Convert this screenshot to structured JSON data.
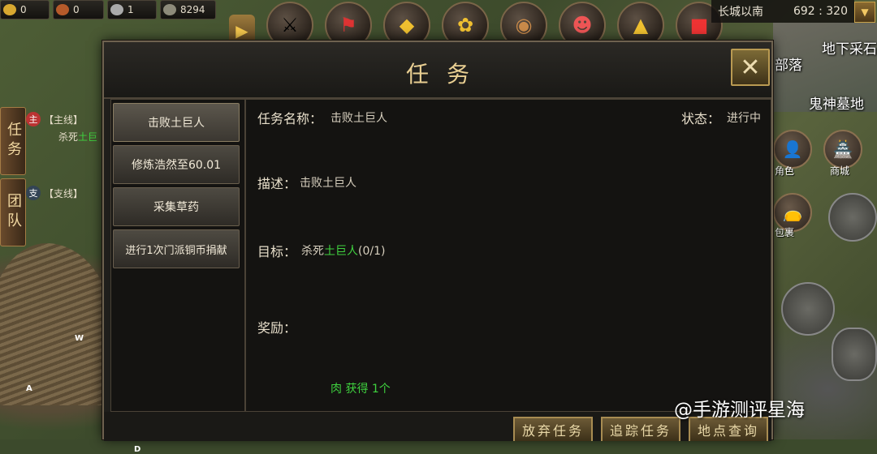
{
  "resources": [
    {
      "icon": "gold-ingot-icon",
      "value": "0"
    },
    {
      "icon": "medal-icon",
      "value": "0"
    },
    {
      "icon": "silver-coin-icon",
      "value": "1"
    },
    {
      "icon": "sack-icon",
      "value": "8294"
    }
  ],
  "top_icons": [
    "expand-arrow-icon",
    "warrior-icon",
    "flag-icon",
    "ingot-icon",
    "gold-tree-icon",
    "shield-icon",
    "mask-icon",
    "treasure-icon",
    "gift-box-icon"
  ],
  "location": {
    "name": "长城以南",
    "coords": "692 : 320"
  },
  "map_labels": {
    "tribe": "部落",
    "cave": "地下采石",
    "tomb": "鬼神墓地"
  },
  "side_tabs": {
    "quest": "任务",
    "team": "团队"
  },
  "tracker": {
    "main": {
      "badge": "主",
      "tag": "【主线】",
      "desc": "杀死",
      "target": "土巨"
    },
    "side": {
      "badge": "支",
      "tag": "【支线】"
    }
  },
  "right_buttons": {
    "character": "角色",
    "shop": "商城",
    "bag": "包裹"
  },
  "dialog": {
    "title": "任务",
    "close": "✕",
    "quests": [
      "击败土巨人",
      "修炼浩然至60.01",
      "采集草药",
      "进行1次门派铜币捐献"
    ],
    "detail": {
      "name_label": "任务名称：",
      "name": "击败土巨人",
      "status_label": "状态：",
      "status": "进行中",
      "desc_label": "描述：",
      "desc": "击败土巨人",
      "goal_label": "目标：",
      "goal_prefix": "杀死",
      "goal_target": "土巨人",
      "goal_progress": "(0/1)",
      "reward_label": "奖励：",
      "reward": "肉 获得 1个"
    },
    "actions": {
      "abandon": "放弃任务",
      "track": "追踪任务",
      "locate": "地点查询"
    },
    "corner_letter": "D"
  },
  "map_markers": {
    "w": "W",
    "a": "A"
  },
  "watermark": "@手游测评星海",
  "colors": {
    "accent_gold": "#e9cf92",
    "quest_target_green": "#3fd23f"
  }
}
